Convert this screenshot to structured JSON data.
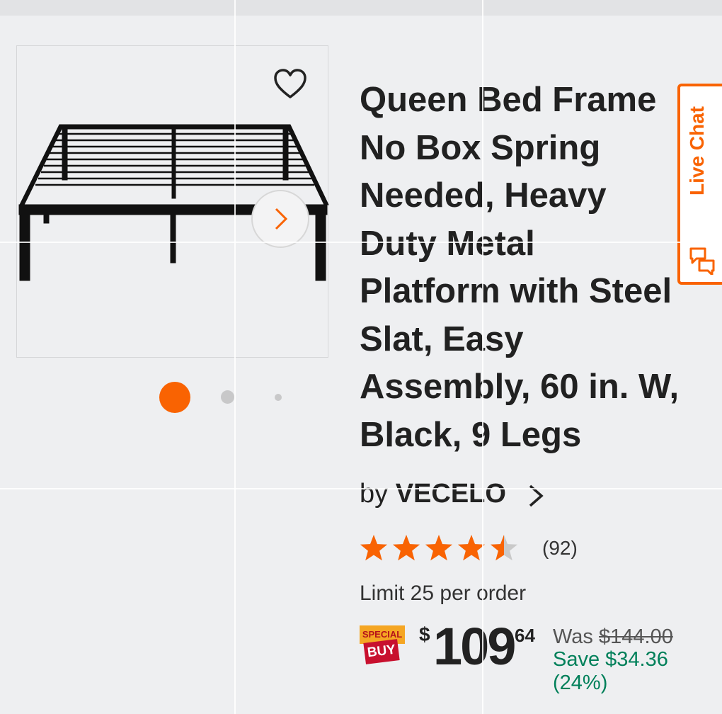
{
  "product": {
    "title": "Queen Bed Frame\nNo Box Spring\nNeeded, Heavy\nDuty Metal\nPlatform with Steel\nSlat, Easy\nAssembly, 60 in. W,\nBlack, 9 Legs",
    "brand_prefix": "by",
    "brand": "VECELO",
    "rating": 4.5,
    "rating_max": 5,
    "review_count": "(92)",
    "limit": "Limit 25 per order"
  },
  "gallery": {
    "image_count": 3,
    "active_index": 0
  },
  "badge": {
    "top": "SPECIAL",
    "bottom": "BUY"
  },
  "price": {
    "currency": "$",
    "dollars": "109",
    "cents": "64",
    "was_label": "Was",
    "was_value": "$144.00",
    "save": "Save $34.36 (24%)"
  },
  "live_chat": {
    "label": "Live Chat"
  },
  "colors": {
    "accent": "#f96302",
    "save_green": "#00805a"
  },
  "icons": {
    "favorite": "heart-outline-icon",
    "next": "chevron-right-icon",
    "chat": "chat-bubbles-icon",
    "brand_link": "chevron-right-icon"
  }
}
